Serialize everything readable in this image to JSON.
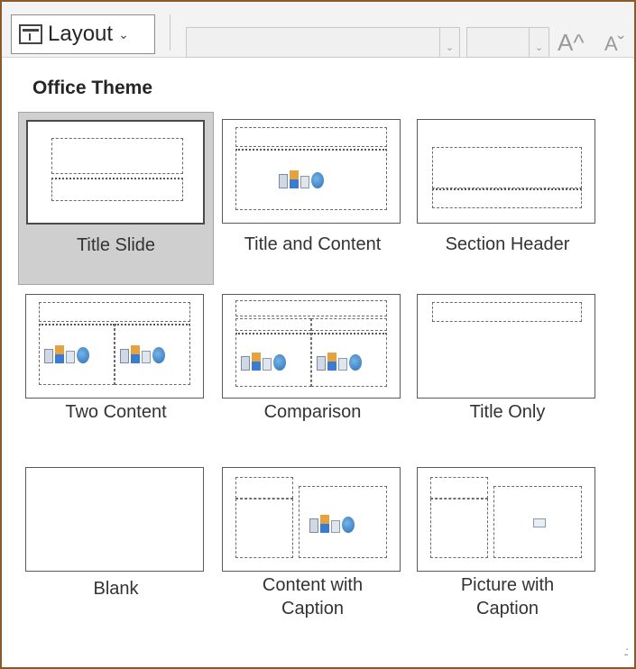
{
  "ribbon": {
    "layout_label": "Layout",
    "grow_font": "A^",
    "shrink_font": "Aˇ"
  },
  "gallery": {
    "section_title": "Office Theme",
    "layouts": [
      {
        "label": "Title Slide",
        "selected": true
      },
      {
        "label": "Title and Content",
        "selected": false
      },
      {
        "label": "Section Header",
        "selected": false
      },
      {
        "label": "Two Content",
        "selected": false
      },
      {
        "label": "Comparison",
        "selected": false
      },
      {
        "label": "Title Only",
        "selected": false
      },
      {
        "label": "Blank",
        "selected": false
      },
      {
        "label": "Content with\nCaption",
        "selected": false
      },
      {
        "label": "Picture with\nCaption",
        "selected": false
      }
    ]
  },
  "colors": {
    "window_border": "#8a5a2b",
    "selected_bg": "#cfcfcf"
  }
}
